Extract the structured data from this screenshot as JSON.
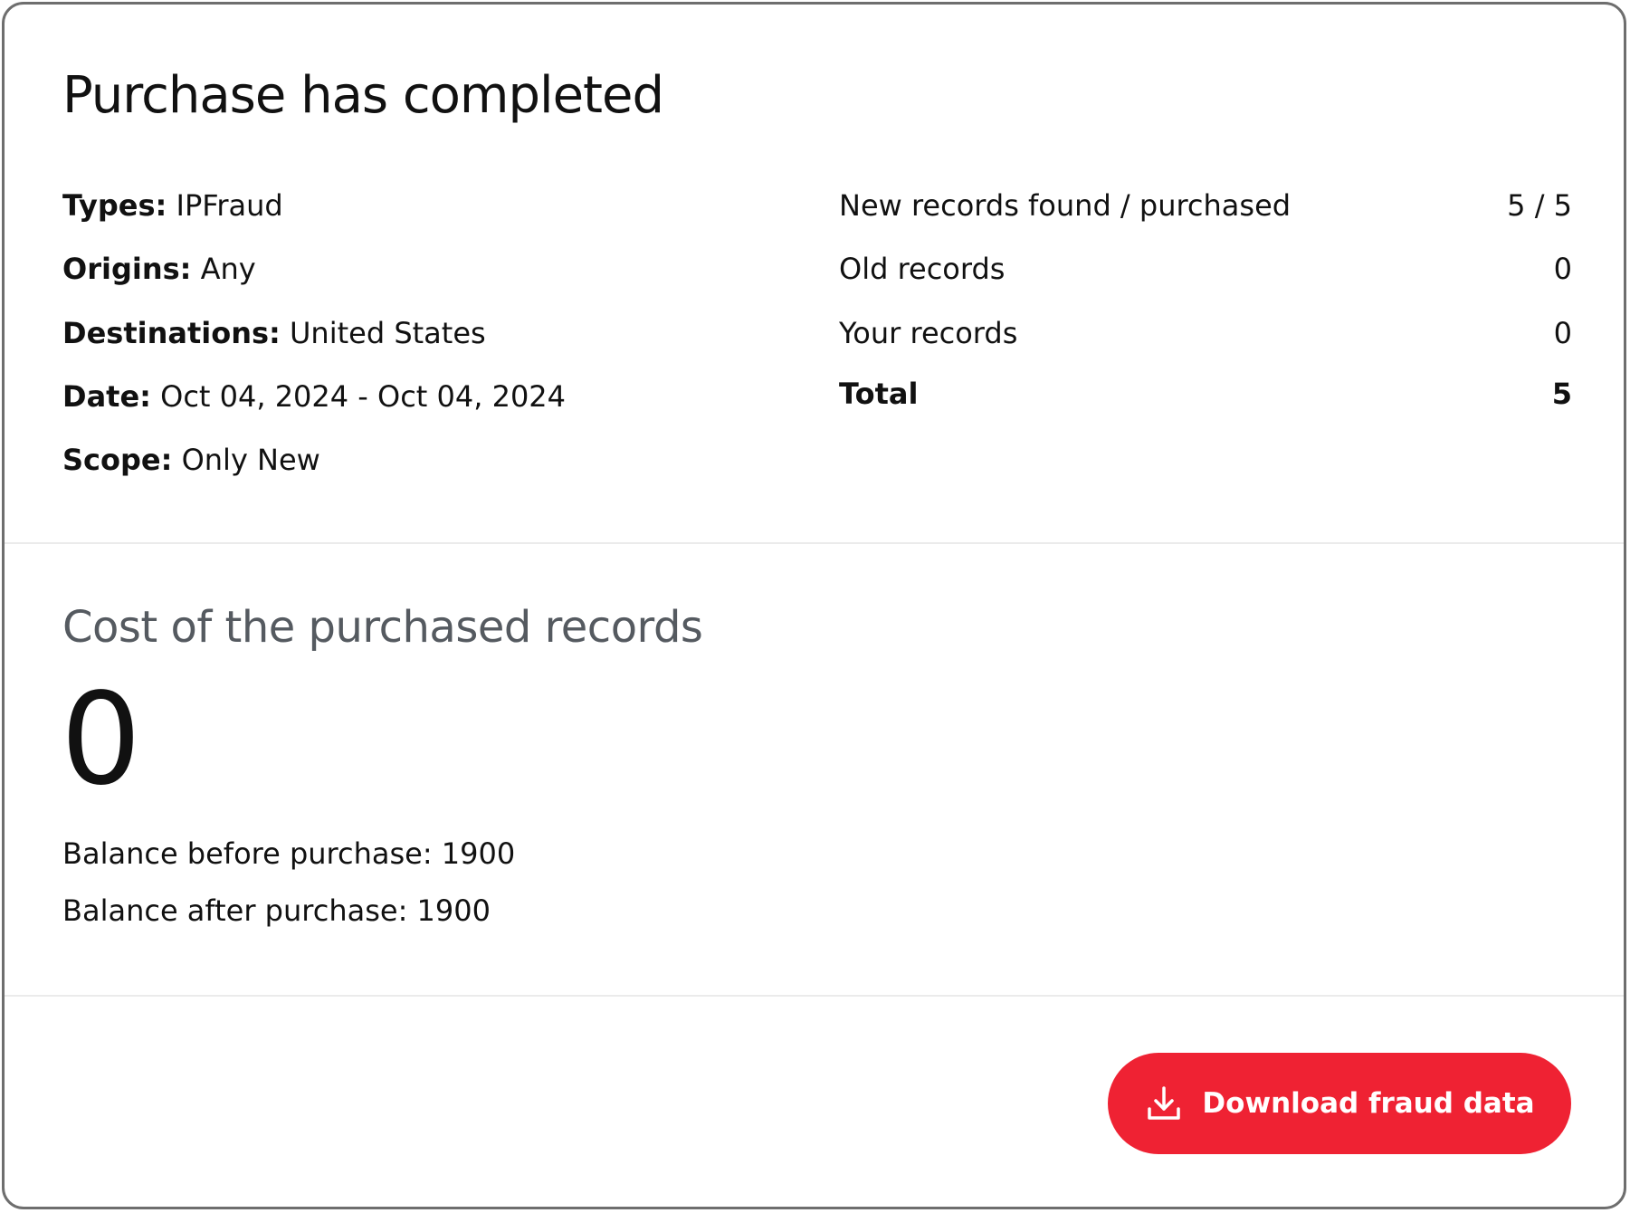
{
  "header": {
    "title": "Purchase has completed"
  },
  "details": {
    "types": {
      "label": "Types:",
      "value": "IPFraud"
    },
    "origins": {
      "label": "Origins:",
      "value": "Any"
    },
    "destinations": {
      "label": "Destinations:",
      "value": "United States"
    },
    "date": {
      "label": "Date:",
      "value": "Oct 04, 2024 - Oct 04, 2024"
    },
    "scope": {
      "label": "Scope:",
      "value": "Only New"
    }
  },
  "stats": {
    "new_records": {
      "label": "New records found / purchased",
      "value": "5 / 5"
    },
    "old_records": {
      "label": "Old records",
      "value": "0"
    },
    "your_records": {
      "label": "Your records",
      "value": "0"
    },
    "total": {
      "label": "Total",
      "value": "5"
    }
  },
  "cost": {
    "title": "Cost of the purchased records",
    "value": "0",
    "balance_before": "Balance before purchase: 1900",
    "balance_after": "Balance after purchase: 1900"
  },
  "actions": {
    "download_label": "Download fraud data",
    "download_icon": "download-icon",
    "button_color": "#ef2233"
  }
}
